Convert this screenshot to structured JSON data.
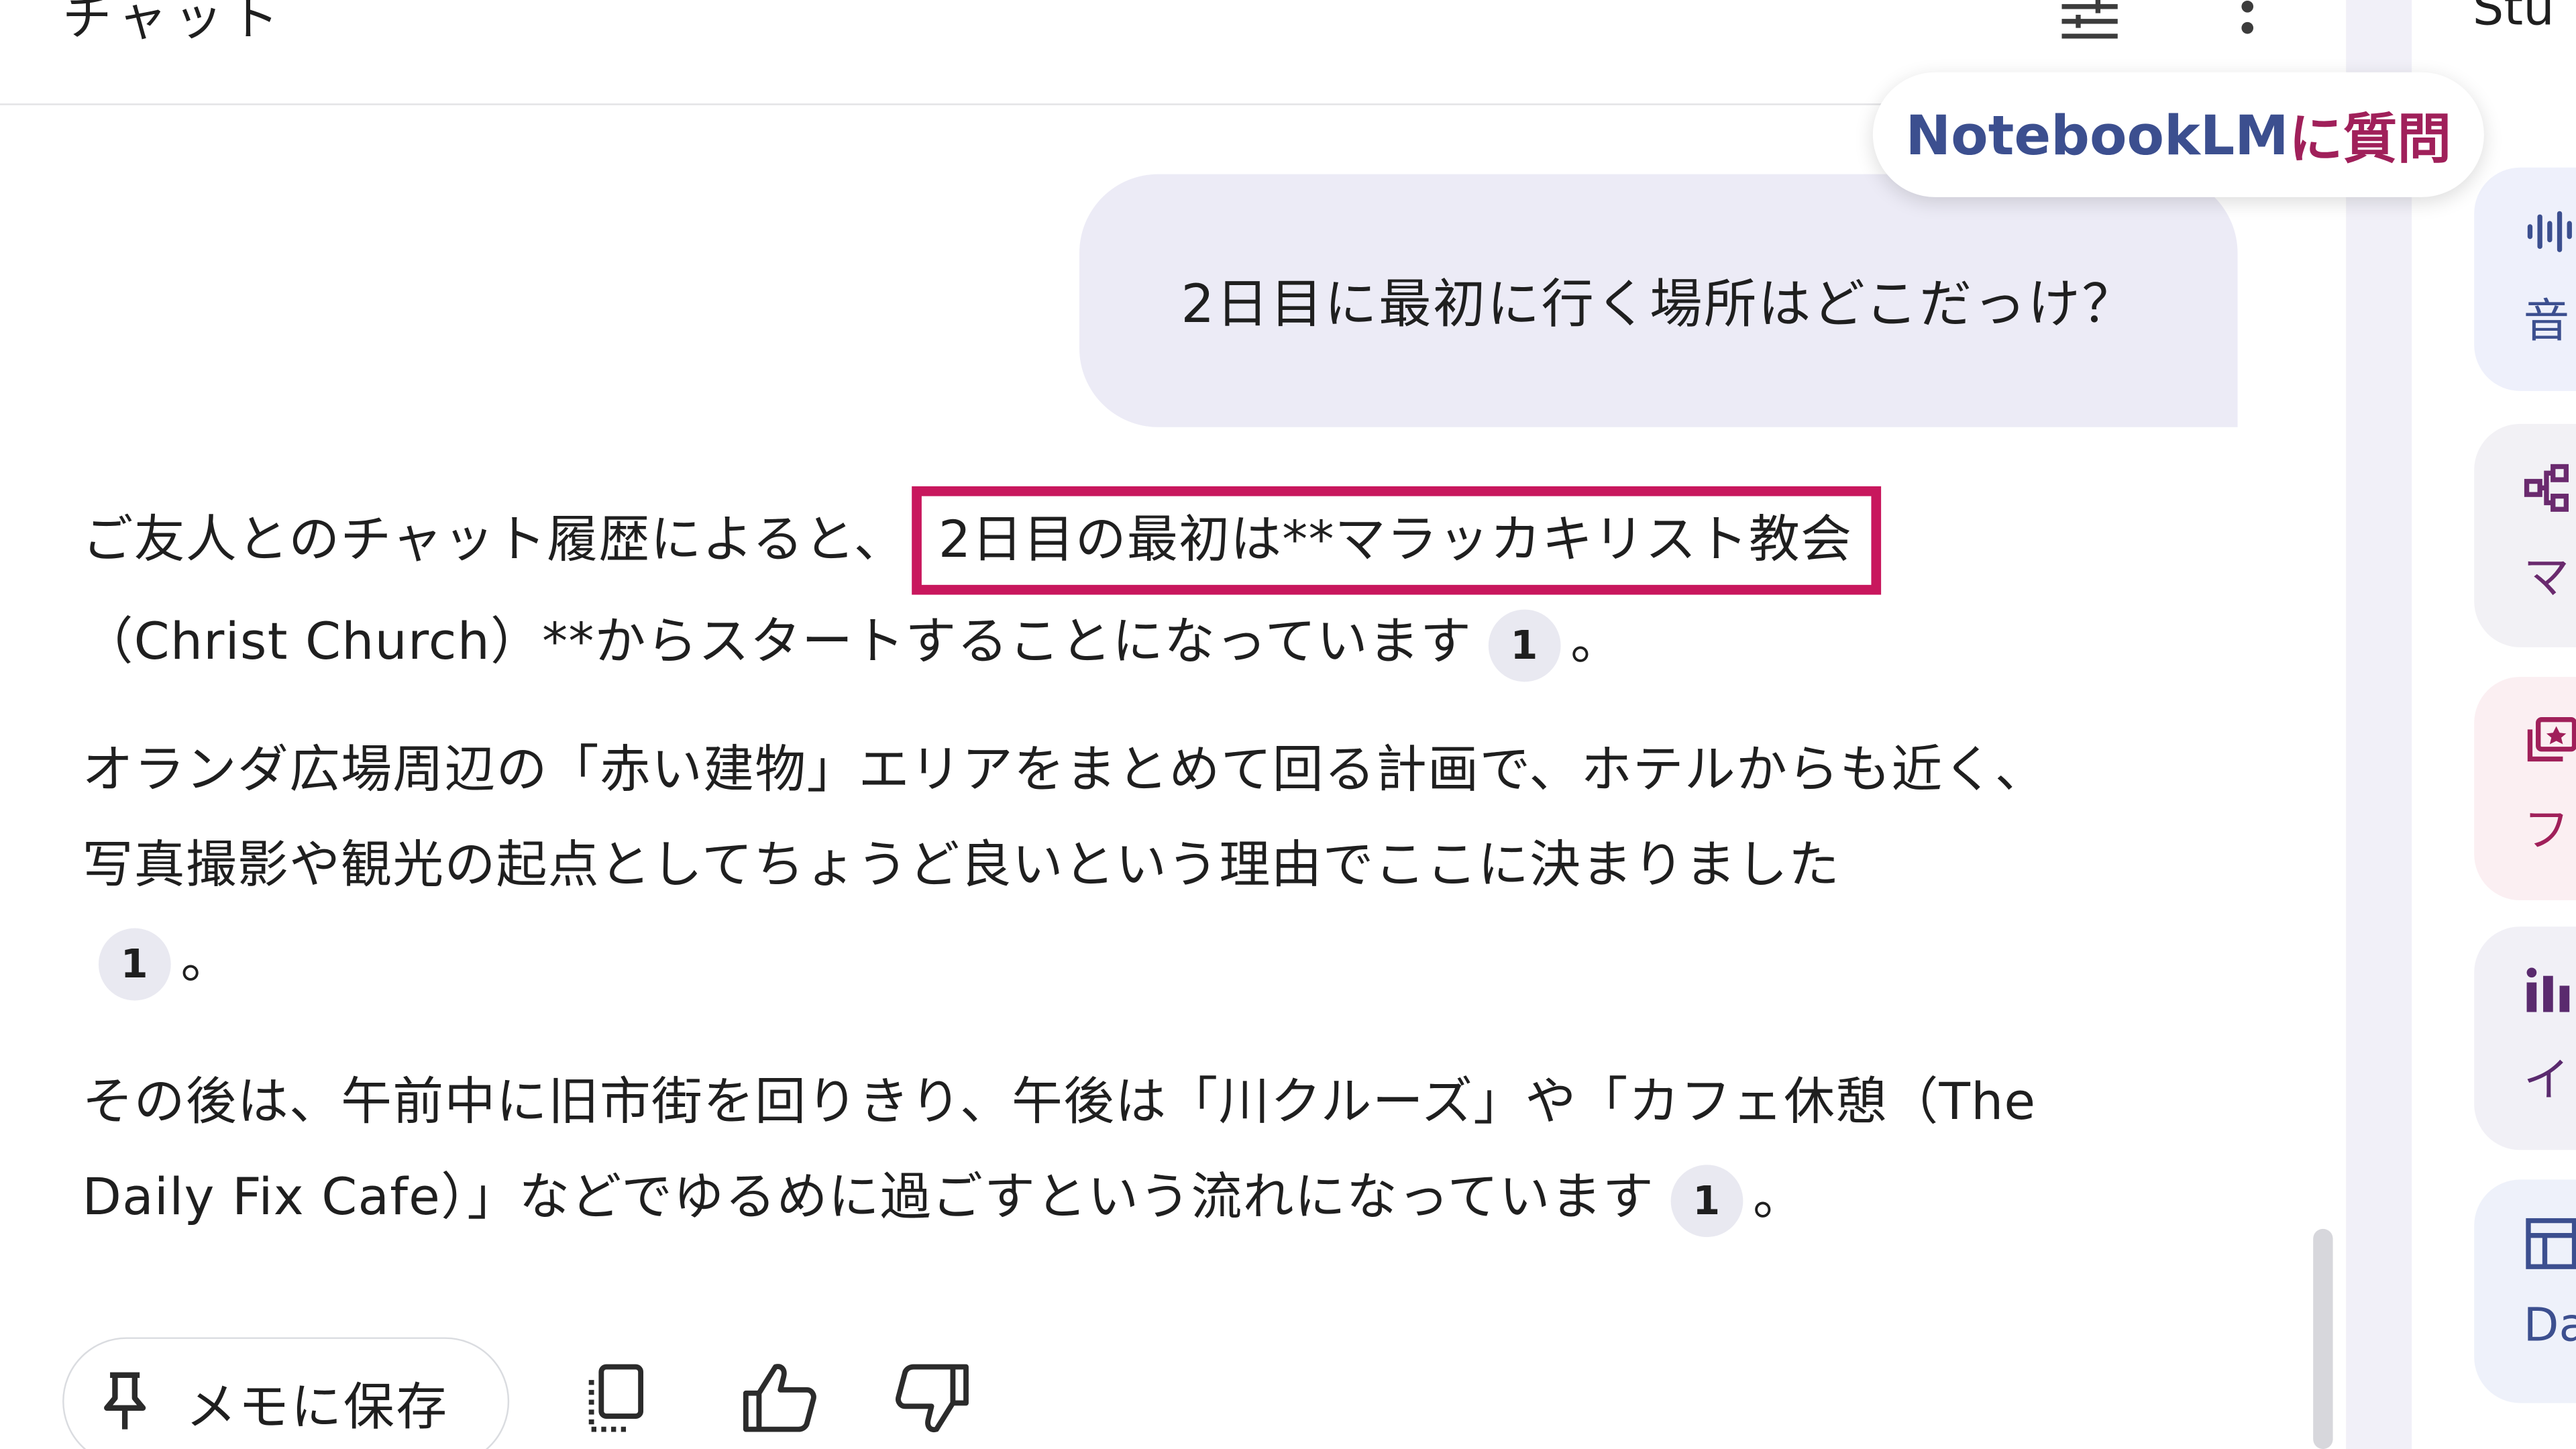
{
  "header": {
    "title": "チャット",
    "tune_icon": "tune-icon",
    "more_icon": "more-vert-icon"
  },
  "tooltip": {
    "part_a": "NotebookLM",
    "part_b": "に質問"
  },
  "query": {
    "text": "2日目に最初に行く場所はどこだっけ？"
  },
  "answer": {
    "p1_before": "ご友人とのチャット履歴によると、",
    "p1_highlight": "2日目の最初は**マラッカキリスト教会",
    "p1_after": "（Christ Church）**からスタートすることになっています",
    "p1_cite": "1",
    "p1_end": "。",
    "p2_text": "オランダ広場周辺の「赤い建物」エリアをまとめて回る計画で、ホテルからも近く、写真撮影や観光の起点としてちょうど良いという理由でここに決まりました",
    "p2_cite": "1",
    "p2_end": "。",
    "p3_text": "その後は、午前中に旧市街を回りきり、午後は「川クルーズ」や「カフェ休憩（The Daily Fix Cafe）」などでゆるめに過ごすという流れになっています",
    "p3_cite": "1",
    "p3_end": "。"
  },
  "actions": {
    "save_label": "メモに保存",
    "save_icon": "pin-icon",
    "copy_icon": "copy-icon",
    "thumb_up_icon": "thumb-up-icon",
    "thumb_down_icon": "thumb-down-icon"
  },
  "studio": {
    "title": "Stu",
    "cards": [
      {
        "label": "音",
        "icon": "audio-icon",
        "color": "#3c4f8f"
      },
      {
        "label": "マ",
        "icon": "mindmap-icon",
        "color": "#6a2a6e"
      },
      {
        "label": "フ",
        "icon": "flashcard-icon",
        "color": "#a0205a"
      },
      {
        "label": "イ",
        "icon": "infographic-icon",
        "color": "#5a2a6e"
      },
      {
        "label": "Da",
        "icon": "data-table-icon",
        "color": "#3c4f8f"
      }
    ]
  }
}
